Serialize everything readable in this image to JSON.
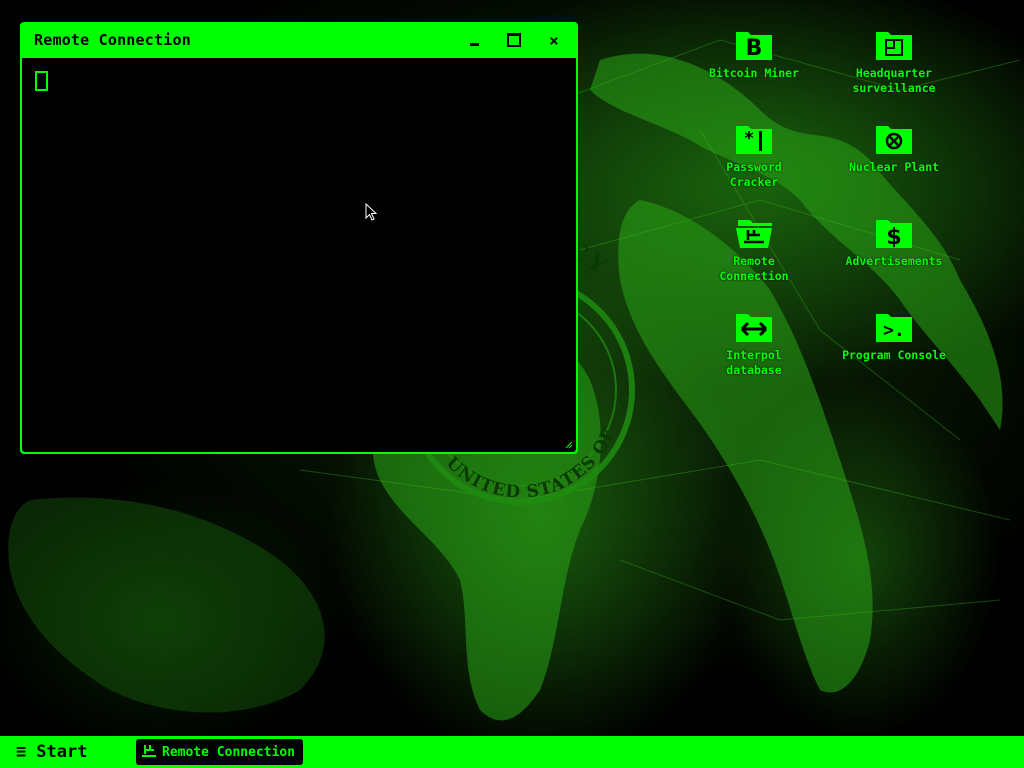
{
  "colors": {
    "accent": "#00ff00",
    "background": "#000000"
  },
  "window": {
    "title": "Remote Connection",
    "minimize_icon": "minimize-icon",
    "maximize_icon": "maximize-icon",
    "close_label": "×",
    "terminal_prompt": "block-cursor"
  },
  "wallpaper": {
    "seal_text_top": "AGENCY",
    "seal_text_bottom": "UNITED STATES OF AMERICA"
  },
  "desktop_icons": [
    {
      "label": "Bitcoin Miner",
      "icon": "bitcoin-b-icon"
    },
    {
      "label": "Headquarter\nsurveillance",
      "icon": "surveillance-icon"
    },
    {
      "label": "Password\nCracker",
      "icon": "password-cracker-icon"
    },
    {
      "label": "Nuclear Plant",
      "icon": "nuclear-icon"
    },
    {
      "label": "Remote\nConnection",
      "icon": "remote-connection-icon"
    },
    {
      "label": "Advertisements",
      "icon": "dollar-icon"
    },
    {
      "label": "Interpol\ndatabase",
      "icon": "exchange-arrows-icon"
    },
    {
      "label": "Program Console",
      "icon": "console-prompt-icon"
    }
  ],
  "taskbar": {
    "start_label": "Start",
    "start_icon": "hamburger-icon",
    "open_task_label": "Remote Connection",
    "open_task_icon": "remote-connection-icon"
  }
}
